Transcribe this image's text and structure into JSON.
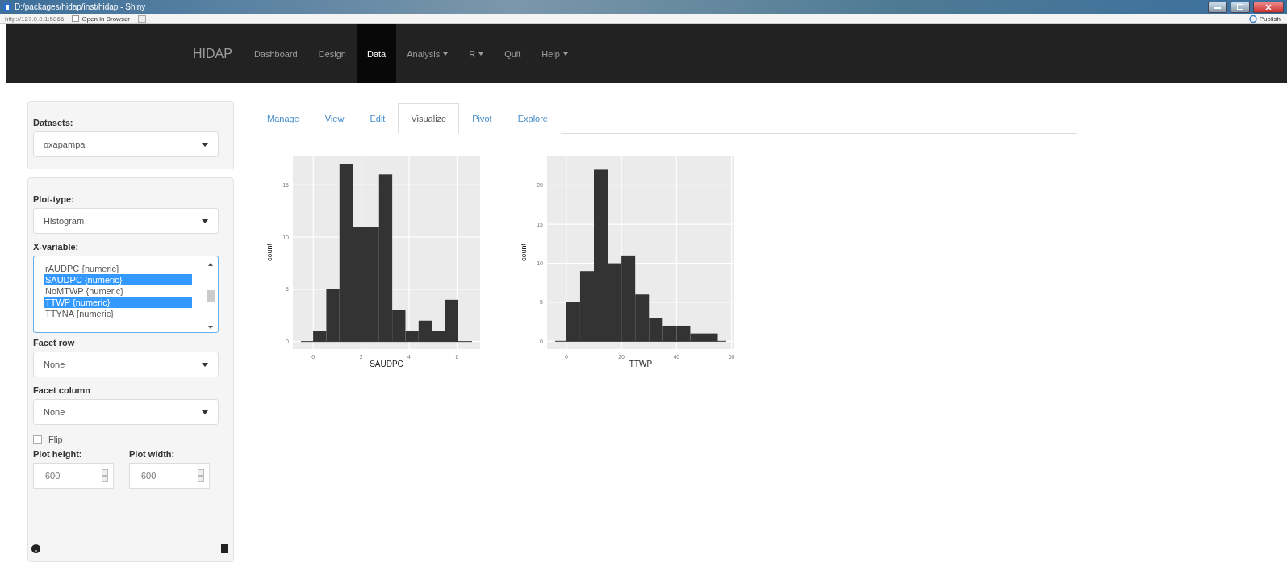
{
  "window": {
    "title": "D:/packages/hidap/inst/hidap - Shiny",
    "url": "http://127.0.0.1:5866",
    "open_button": "Open in Browser",
    "publish": "Publish"
  },
  "navbar": {
    "brand": "HIDAP",
    "items": [
      {
        "label": "Dashboard",
        "selected": false,
        "dropdown": false
      },
      {
        "label": "Design",
        "selected": false,
        "dropdown": false
      },
      {
        "label": "Data",
        "selected": true,
        "dropdown": false
      },
      {
        "label": "Analysis",
        "selected": false,
        "dropdown": true
      },
      {
        "label": "R",
        "selected": false,
        "dropdown": true
      },
      {
        "label": "Quit",
        "selected": false,
        "dropdown": false
      },
      {
        "label": "Help",
        "selected": false,
        "dropdown": true
      }
    ]
  },
  "sidebar": {
    "datasets": {
      "label": "Datasets:",
      "value": "oxapampa"
    },
    "plot_type": {
      "label": "Plot-type:",
      "value": "Histogram"
    },
    "x_variable": {
      "label": "X-variable:",
      "options": [
        {
          "label": "rAUDPC {numeric}",
          "selected": false
        },
        {
          "label": "SAUDPC {numeric}",
          "selected": true
        },
        {
          "label": "NoMTWP {numeric}",
          "selected": false
        },
        {
          "label": "TTWP {numeric}",
          "selected": true
        },
        {
          "label": "TTYNA {numeric}",
          "selected": false
        }
      ]
    },
    "facet_row": {
      "label": "Facet row",
      "value": "None"
    },
    "facet_column": {
      "label": "Facet column",
      "value": "None"
    },
    "flip": {
      "label": "Flip",
      "checked": false
    },
    "plot_height": {
      "label": "Plot height:",
      "value": "600"
    },
    "plot_width": {
      "label": "Plot width:",
      "value": "600"
    }
  },
  "tabs": [
    {
      "label": "Manage",
      "selected": false
    },
    {
      "label": "View",
      "selected": false
    },
    {
      "label": "Edit",
      "selected": false
    },
    {
      "label": "Visualize",
      "selected": true
    },
    {
      "label": "Pivot",
      "selected": false
    },
    {
      "label": "Explore",
      "selected": false
    }
  ],
  "charts": [
    {
      "chart_data": {
        "type": "bar",
        "xlabel": "SAUDPC",
        "ylabel": "count",
        "x": [
          0.27,
          0.82,
          1.37,
          1.92,
          2.47,
          3.02,
          3.57,
          4.12,
          4.67,
          5.22,
          5.77
        ],
        "grid": true,
        "series": [
          {
            "color": "#333333",
            "values": [
              1,
              5,
              17,
              11,
              11,
              16,
              3,
              1,
              2,
              1,
              4
            ]
          }
        ],
        "xlim": [
          -0.85,
          6.96
        ],
        "ylim": [
          -0.72,
          17.8
        ],
        "xticks": [
          0,
          2,
          4,
          6
        ],
        "yticks": [
          0,
          5,
          10,
          15
        ]
      }
    },
    {
      "chart_data": {
        "type": "bar",
        "xlabel": "TTWP",
        "ylabel": "count",
        "x": [
          2.5,
          7.5,
          12.5,
          17.5,
          22.5,
          27.5,
          32.5,
          37.5,
          42.5,
          47.5,
          52.5
        ],
        "grid": true,
        "series": [
          {
            "color": "#333333",
            "values": [
              5,
              9,
              22,
              10,
              11,
              6,
              3,
              2,
              2,
              1,
              1
            ]
          }
        ],
        "xlim": [
          -7,
          61
        ],
        "ylim": [
          -1,
          23.8
        ],
        "xticks": [
          0,
          20,
          40,
          60
        ],
        "yticks": [
          0,
          5,
          10,
          15,
          20
        ]
      }
    }
  ]
}
